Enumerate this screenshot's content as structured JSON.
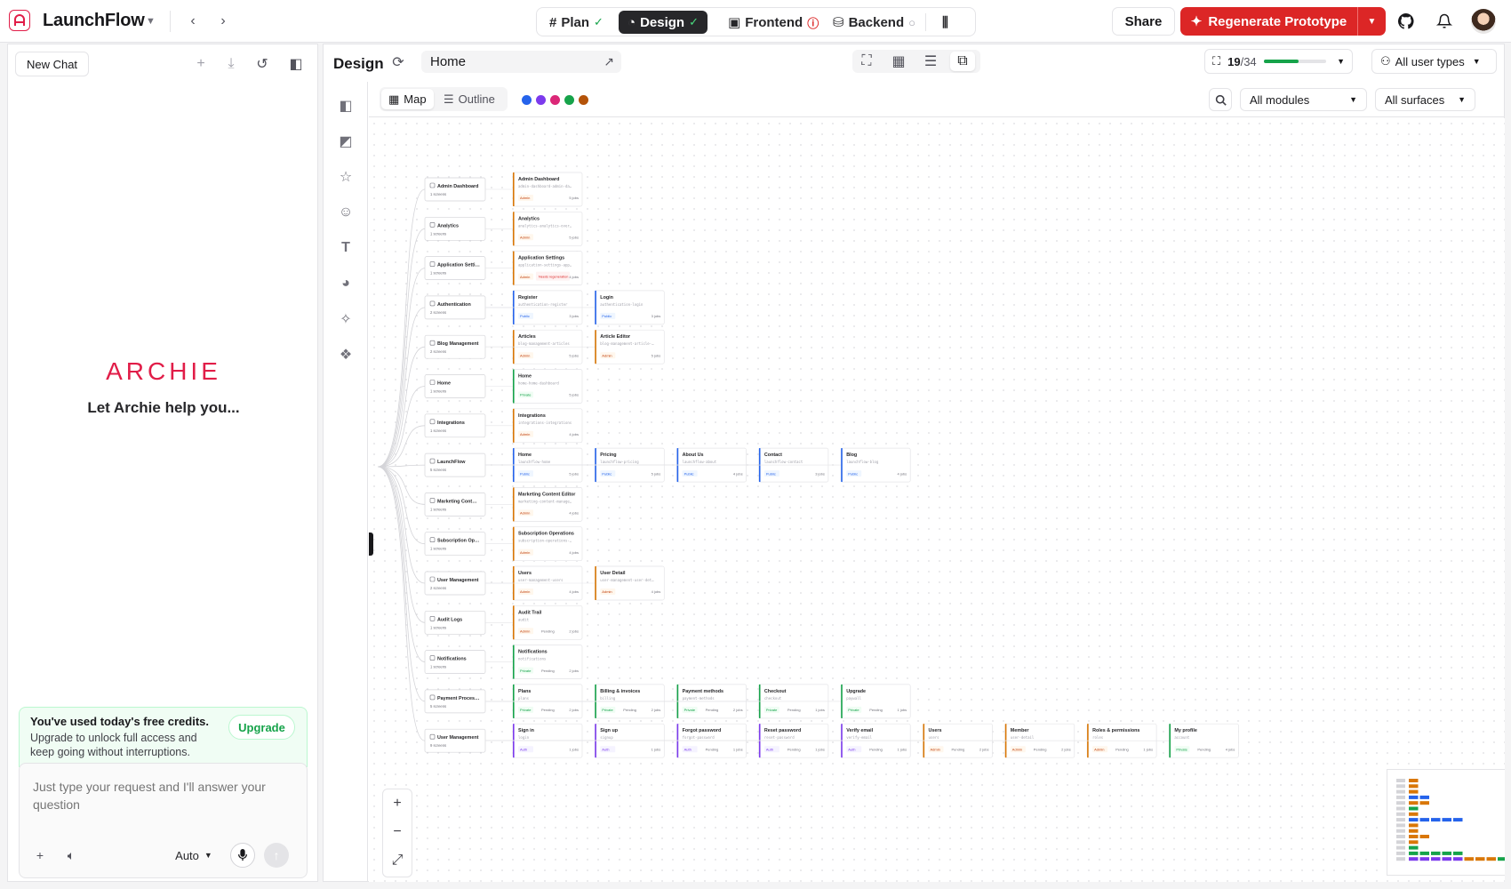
{
  "app": {
    "name": "LaunchFlow"
  },
  "stages": [
    {
      "label": "Plan",
      "status": "done"
    },
    {
      "label": "Design",
      "status": "done"
    },
    {
      "label": "Frontend",
      "status": "error"
    },
    {
      "label": "Backend",
      "status": "pending"
    }
  ],
  "header": {
    "share_label": "Share",
    "regenerate_label": "Regenerate Prototype"
  },
  "chat": {
    "new_chat_label": "New Chat",
    "brand": "ARCHIE",
    "tagline": "Let Archie help you...",
    "credits_title": "You've used today's free credits.",
    "credits_body": "Upgrade to unlock full access and keep going without interruptions.",
    "upgrade_label": "Upgrade",
    "input_placeholder": "Just type your request and I'll answer your question",
    "model_label": "Auto"
  },
  "design": {
    "title": "Design",
    "page_value": "Home",
    "progress_done": "19",
    "progress_total": "/34",
    "progress_fraction": 0.5588,
    "user_types_label": "All user types",
    "map_label": "Map",
    "outline_label": "Outline",
    "modules_label": "All modules",
    "surfaces_label": "All surfaces",
    "colors": [
      "#2563eb",
      "#7c3aed",
      "#db2777",
      "#16a34a",
      "#b45309"
    ]
  },
  "flow": {
    "modules": [
      {
        "name": "Admin Dashboard",
        "count": "1 screens",
        "screens": [
          {
            "t": "Admin Dashboard",
            "s": "admin-dashboard-admin-da…",
            "tag": "Admin",
            "j": "5 jobs"
          }
        ]
      },
      {
        "name": "Analytics",
        "count": "1 screens",
        "screens": [
          {
            "t": "Analytics",
            "s": "analytics-analytics-over…",
            "tag": "Admin",
            "j": "5 jobs"
          }
        ]
      },
      {
        "name": "Application Setti…",
        "count": "1 screens",
        "screens": [
          {
            "t": "Application Settings",
            "s": "application-settings-app…",
            "tag": "Admin",
            "badge": "Needs regeneration",
            "j": "4 jobs"
          }
        ]
      },
      {
        "name": "Authentication",
        "count": "2 screens",
        "screens": [
          {
            "t": "Register",
            "s": "authentication-register",
            "tag": "Public",
            "j": "3 jobs"
          },
          {
            "t": "Login",
            "s": "authentication-login",
            "tag": "Public",
            "j": "3 jobs"
          }
        ]
      },
      {
        "name": "Blog Management",
        "count": "2 screens",
        "screens": [
          {
            "t": "Articles",
            "s": "blog-management-articles",
            "tag": "Admin",
            "j": "5 jobs"
          },
          {
            "t": "Article Editor",
            "s": "blog-management-article-…",
            "tag": "Admin",
            "j": "5 jobs"
          }
        ]
      },
      {
        "name": "Home",
        "count": "1 screens",
        "screens": [
          {
            "t": "Home",
            "s": "home-home-dashboard",
            "tag": "Private",
            "j": "5 jobs"
          }
        ]
      },
      {
        "name": "Integrations",
        "count": "1 screens",
        "screens": [
          {
            "t": "Integrations",
            "s": "integrations-integrations",
            "tag": "Admin",
            "j": "4 jobs"
          }
        ]
      },
      {
        "name": "LaunchFlow",
        "count": "5 screens",
        "screens": [
          {
            "t": "Home",
            "s": "launchflow-home",
            "tag": "Public",
            "j": "5 jobs"
          },
          {
            "t": "Pricing",
            "s": "launchflow-pricing",
            "tag": "Public",
            "j": "5 jobs"
          },
          {
            "t": "About Us",
            "s": "launchflow-about",
            "tag": "Public",
            "j": "4 jobs"
          },
          {
            "t": "Contact",
            "s": "launchflow-contact",
            "tag": "Public",
            "j": "3 jobs"
          },
          {
            "t": "Blog",
            "s": "launchflow-blog",
            "tag": "Public",
            "j": "4 jobs"
          }
        ]
      },
      {
        "name": "Marketing Cont…",
        "count": "1 screens",
        "screens": [
          {
            "t": "Marketing Content Editor",
            "s": "marketing-content-manage…",
            "tag": "Admin",
            "j": "4 jobs"
          }
        ]
      },
      {
        "name": "Subscription Op…",
        "count": "1 screens",
        "screens": [
          {
            "t": "Subscription Operations",
            "s": "subscription-operations-…",
            "tag": "Admin",
            "j": "4 jobs"
          }
        ]
      },
      {
        "name": "User Management",
        "count": "2 screens",
        "screens": [
          {
            "t": "Users",
            "s": "user-management-users",
            "tag": "Admin",
            "j": "4 jobs"
          },
          {
            "t": "User Detail",
            "s": "user-management-user-det…",
            "tag": "Admin",
            "j": "4 jobs"
          }
        ]
      },
      {
        "name": "Audit Logs",
        "count": "1 screens",
        "screens": [
          {
            "t": "Audit Trail",
            "s": "audit",
            "tag": "Admin",
            "p": "Pending",
            "j": "2 jobs"
          }
        ]
      },
      {
        "name": "Notifications",
        "count": "1 screens",
        "screens": [
          {
            "t": "Notifications",
            "s": "notifications",
            "tag": "Private",
            "p": "Pending",
            "j": "2 jobs"
          }
        ]
      },
      {
        "name": "Payment Proces…",
        "count": "5 screens",
        "screens": [
          {
            "t": "Plans",
            "s": "plans",
            "tag": "Private",
            "p": "Pending",
            "j": "2 jobs"
          },
          {
            "t": "Billing & invoices",
            "s": "billing",
            "tag": "Private",
            "p": "Pending",
            "j": "2 jobs"
          },
          {
            "t": "Payment methods",
            "s": "payment-methods",
            "tag": "Private",
            "p": "Pending",
            "j": "2 jobs"
          },
          {
            "t": "Checkout",
            "s": "checkout",
            "tag": "Private",
            "p": "Pending",
            "j": "1 jobs"
          },
          {
            "t": "Upgrade",
            "s": "paywall",
            "tag": "Private",
            "p": "Pending",
            "j": "1 jobs"
          }
        ]
      },
      {
        "name": "User Management",
        "count": "9 screens",
        "screens": [
          {
            "t": "Sign in",
            "s": "login",
            "tag": "Auth",
            "j": "1 jobs"
          },
          {
            "t": "Sign up",
            "s": "signup",
            "tag": "Auth",
            "j": "1 jobs"
          },
          {
            "t": "Forgot password",
            "s": "forgot-password",
            "tag": "Auth",
            "p": "Pending",
            "j": "1 jobs"
          },
          {
            "t": "Reset password",
            "s": "reset-password",
            "tag": "Auth",
            "p": "Pending",
            "j": "1 jobs"
          },
          {
            "t": "Verify email",
            "s": "verify-email",
            "tag": "Auth",
            "p": "Pending",
            "j": "1 jobs"
          },
          {
            "t": "Users",
            "s": "users",
            "tag": "Admin",
            "p": "Pending",
            "j": "2 jobs"
          },
          {
            "t": "Member",
            "s": "user-detail",
            "tag": "Admin",
            "p": "Pending",
            "j": "2 jobs"
          },
          {
            "t": "Roles & permissions",
            "s": "roles",
            "tag": "Admin",
            "p": "Pending",
            "j": "1 jobs"
          },
          {
            "t": "My profile",
            "s": "account",
            "tag": "Private",
            "p": "Pending",
            "j": "4 jobs"
          }
        ]
      }
    ]
  }
}
